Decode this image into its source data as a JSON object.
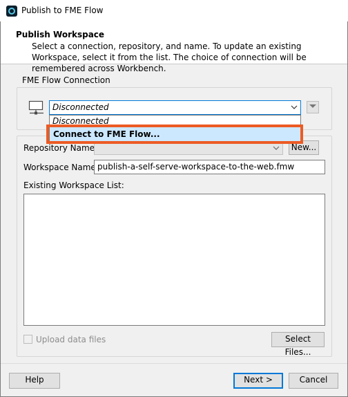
{
  "window": {
    "title": "Publish to FME Flow"
  },
  "header": {
    "title": "Publish Workspace",
    "description": "Select a connection, repository, and name. To update an existing Workspace, select it from the list. The choice of connection will be remembered across Workbench."
  },
  "connection": {
    "group_label": "FME Flow Connection",
    "selected": "Disconnected",
    "options": [
      "Disconnected",
      "Connect to FME Flow..."
    ],
    "highlighted_option": "Connect to FME Flow...",
    "highlight_color": "#ec5b24"
  },
  "repository": {
    "label": "Repository Name:",
    "value": "",
    "new_button": "New..."
  },
  "workspace": {
    "label": "Workspace Name:",
    "value": "publish-a-self-serve-workspace-to-the-web.fmw",
    "list_label": "Existing Workspace List:",
    "items": []
  },
  "upload": {
    "label": "Upload data files",
    "checked": false,
    "enabled": false,
    "select_button": "Select Files..."
  },
  "footer": {
    "help": "Help",
    "next": "Next >",
    "cancel": "Cancel"
  },
  "icons": {
    "app": "fme-app-icon",
    "connection": "computer-network-icon",
    "dropdown": "chevron-down-icon"
  },
  "colors": {
    "accent": "#0078d7",
    "selection": "#cce8ff"
  }
}
